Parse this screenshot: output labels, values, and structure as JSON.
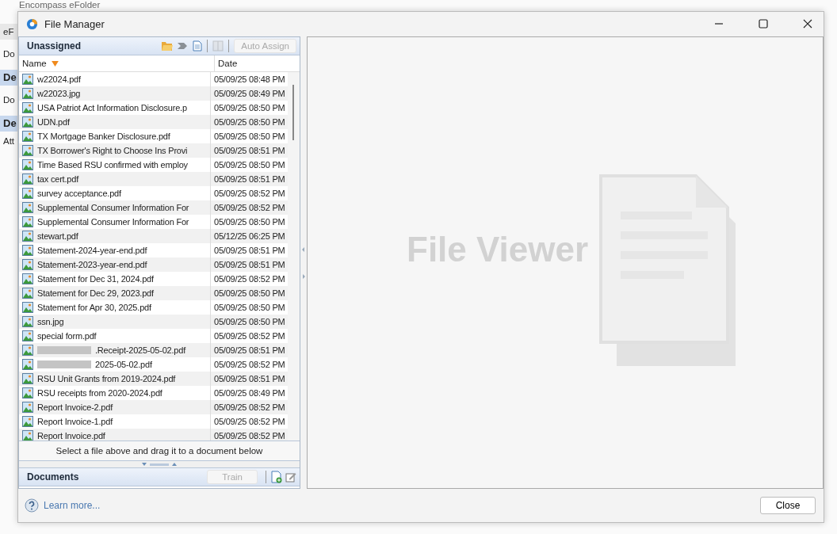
{
  "background_window": {
    "title": "Encompass eFolder",
    "fragments": [
      {
        "text": "eF",
        "kind": "menu"
      },
      {
        "text": "Do",
        "kind": "tab"
      },
      {
        "text": "De",
        "kind": "header"
      },
      {
        "text": "Do",
        "kind": "tab"
      },
      {
        "text": "De",
        "kind": "header"
      },
      {
        "text": "Att",
        "kind": "label"
      }
    ]
  },
  "window": {
    "title": "File Manager"
  },
  "unassigned": {
    "title": "Unassigned",
    "auto_assign": "Auto Assign",
    "columns": [
      {
        "label": "Name",
        "sorted": true
      },
      {
        "label": "Date",
        "sorted": false
      }
    ],
    "rows": [
      {
        "name": "w22024.pdf",
        "date": "05/09/25 08:48 PM"
      },
      {
        "name": "w22023.jpg",
        "date": "05/09/25 08:49 PM"
      },
      {
        "name": "USA Patriot Act Information Disclosure.p",
        "date": "05/09/25 08:50 PM"
      },
      {
        "name": "UDN.pdf",
        "date": "05/09/25 08:50 PM"
      },
      {
        "name": "TX Mortgage Banker Disclosure.pdf",
        "date": "05/09/25 08:50 PM"
      },
      {
        "name": "TX Borrower's Right to Choose Ins Provi",
        "date": "05/09/25 08:51 PM"
      },
      {
        "name": "Time Based RSU confirmed with employ",
        "date": "05/09/25 08:50 PM"
      },
      {
        "name": "tax cert.pdf",
        "date": "05/09/25 08:51 PM"
      },
      {
        "name": "survey acceptance.pdf",
        "date": "05/09/25 08:52 PM"
      },
      {
        "name": "Supplemental Consumer Information For",
        "date": "05/09/25 08:52 PM"
      },
      {
        "name": "Supplemental Consumer Information For",
        "date": "05/09/25 08:50 PM"
      },
      {
        "name": "stewart.pdf",
        "date": "05/12/25 06:25 PM"
      },
      {
        "name": "Statement-2024-year-end.pdf",
        "date": "05/09/25 08:51 PM"
      },
      {
        "name": "Statement-2023-year-end.pdf",
        "date": "05/09/25 08:51 PM"
      },
      {
        "name": "Statement for Dec 31, 2024.pdf",
        "date": "05/09/25 08:52 PM"
      },
      {
        "name": "Statement for Dec 29, 2023.pdf",
        "date": "05/09/25 08:50 PM"
      },
      {
        "name": "Statement for Apr 30, 2025.pdf",
        "date": "05/09/25 08:50 PM"
      },
      {
        "name": "ssn.jpg",
        "date": "05/09/25 08:50 PM"
      },
      {
        "name": "special form.pdf",
        "date": "05/09/25 08:52 PM"
      },
      {
        "name": ".Receipt-2025-05-02.pdf",
        "date": "05/09/25 08:51 PM",
        "redacted": true
      },
      {
        "name": "2025-05-02.pdf",
        "date": "05/09/25 08:52 PM",
        "redacted": true
      },
      {
        "name": "RSU Unit Grants from 2019-2024.pdf",
        "date": "05/09/25 08:51 PM"
      },
      {
        "name": "RSU receipts from 2020-2024.pdf",
        "date": "05/09/25 08:49 PM"
      },
      {
        "name": "Report Invoice-2.pdf",
        "date": "05/09/25 08:52 PM"
      },
      {
        "name": "Report Invoice-1.pdf",
        "date": "05/09/25 08:52 PM"
      },
      {
        "name": "Report Invoice.pdf",
        "date": "05/09/25 08:52 PM"
      }
    ],
    "hint": "Select a file above and drag it to a document below"
  },
  "documents": {
    "title": "Documents",
    "train": "Train"
  },
  "viewer": {
    "watermark": "File Viewer"
  },
  "footer": {
    "learn_more": "Learn more...",
    "close": "Close"
  }
}
